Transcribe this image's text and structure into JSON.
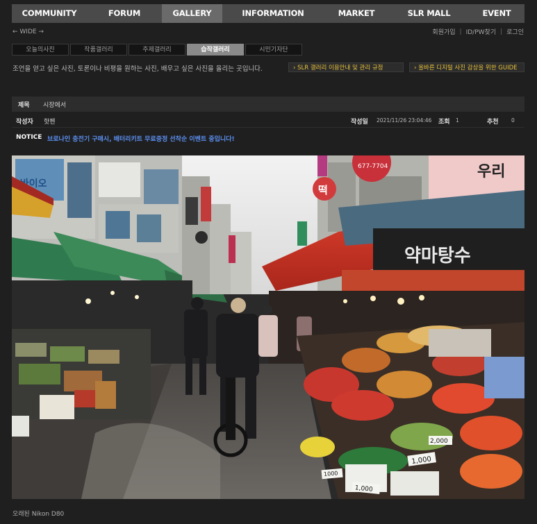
{
  "nav": {
    "items": [
      "COMMUNITY",
      "FORUM",
      "GALLERY",
      "INFORMATION",
      "MARKET",
      "SLR MALL",
      "EVENT"
    ],
    "active_index": 2
  },
  "wide_toggle": "← WIDE →",
  "user_links": [
    "회원가입",
    "ID/PW찾기",
    "로그인"
  ],
  "gallery_tabs": [
    "오늘의사진",
    "작품갤러리",
    "주제갤러리",
    "습작갤러리",
    "시민기자단"
  ],
  "gallery_active_index": 3,
  "description": "조언을 얻고 싶은 사진, 토론이나 비평을 원하는 사진, 배우고 싶은 사진을 올리는 곳입니다.",
  "guides": [
    "› SLR 갤러리 이용안내 및 관리 규정",
    "› 올바른 디지털 사진 감상을 위한 GUIDE"
  ],
  "post": {
    "title_label": "제목",
    "title": "시장에서",
    "author_label": "작성자",
    "author": "핫펜",
    "date_label": "작성일",
    "date": "2021/11/26 23:04:46",
    "views_label": "조회",
    "views": "1",
    "recommend_label": "추천",
    "recommend": "0"
  },
  "notice": {
    "label": "NOTICE",
    "text": "브로나인 충전기 구매시, 배터리키트 무료증정 선착순 이벤트 중입니다!"
  },
  "photo": {
    "signs": [
      "-바이오",
      "떡",
      "약마탕수",
      "우리",
      "677-7704"
    ],
    "price_tags": [
      "1,000",
      "2,000",
      "1,000",
      "1000"
    ]
  },
  "camera": "오래된 Nikon D80",
  "colors": {
    "accent": "#e8c23a",
    "link": "#5b8ff0",
    "background": "#1f1f1f"
  }
}
